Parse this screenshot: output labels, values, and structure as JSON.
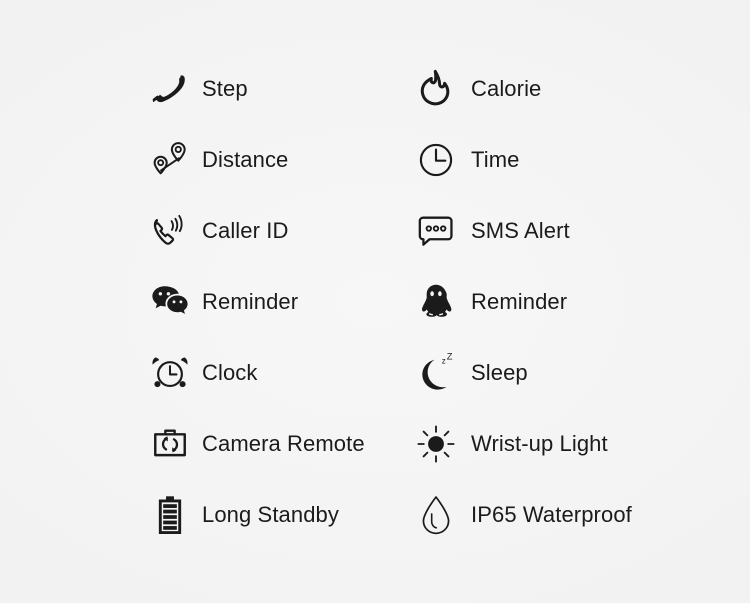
{
  "background_color": "#f4f4f4",
  "text_color": "#1b1b1b",
  "icon_color": "#1b1b1b",
  "features": {
    "columns": [
      {
        "name": "left-column",
        "items": [
          {
            "icon": "shoe-icon",
            "label": "Step"
          },
          {
            "icon": "map-pins-route-icon",
            "label": "Distance"
          },
          {
            "icon": "phone-ringing-icon",
            "label": "Caller ID"
          },
          {
            "icon": "wechat-icon",
            "label": "Reminder"
          },
          {
            "icon": "alarm-clock-icon",
            "label": "Clock"
          },
          {
            "icon": "camera-remote-icon",
            "label": "Camera Remote"
          },
          {
            "icon": "battery-icon",
            "label": "Long Standby"
          }
        ]
      },
      {
        "name": "right-column",
        "items": [
          {
            "icon": "flame-icon",
            "label": "Calorie"
          },
          {
            "icon": "clock-icon",
            "label": "Time"
          },
          {
            "icon": "sms-bubble-icon",
            "label": "SMS Alert"
          },
          {
            "icon": "qq-penguin-icon",
            "label": "Reminder"
          },
          {
            "icon": "moon-sleep-icon",
            "label": "Sleep"
          },
          {
            "icon": "sun-icon",
            "label": "Wrist-up Light"
          },
          {
            "icon": "water-drop-icon",
            "label": "IP65 Waterproof"
          }
        ]
      }
    ]
  }
}
